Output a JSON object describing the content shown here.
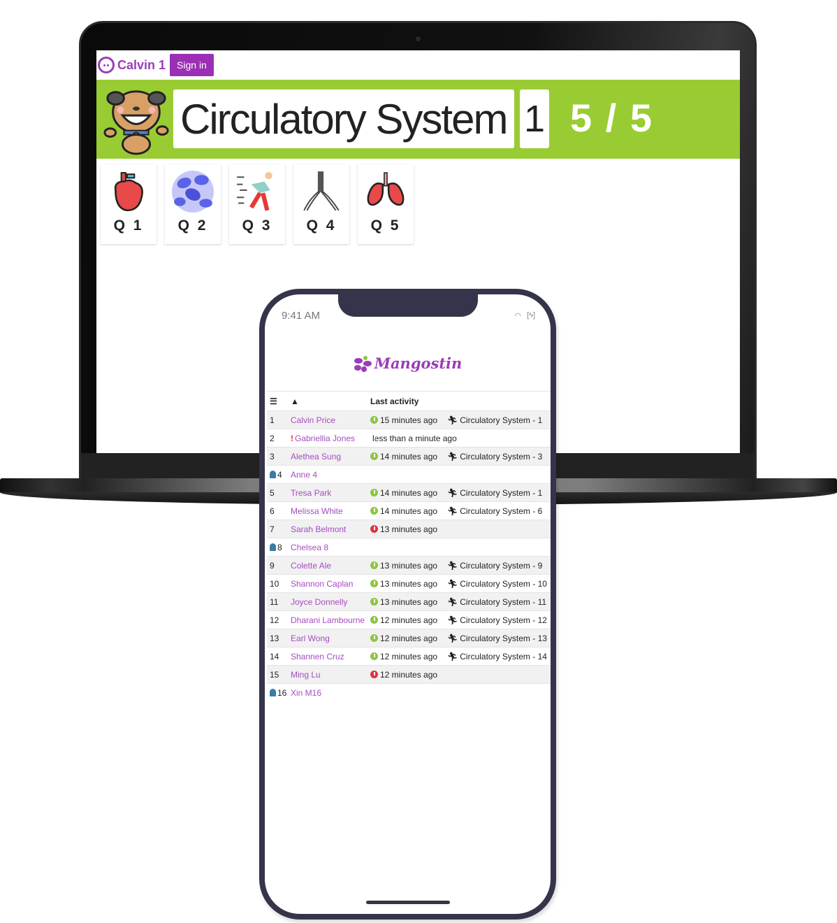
{
  "laptop": {
    "user_name": "Calvin 1",
    "signin_label": "Sign in",
    "quiz_title": "Circulatory System",
    "quiz_number": "1",
    "score": "5 / 5",
    "questions": [
      {
        "label": "Q 1",
        "icon": "heart-icon"
      },
      {
        "label": "Q 2",
        "icon": "blood-cells-icon"
      },
      {
        "label": "Q 3",
        "icon": "runner-icon"
      },
      {
        "label": "Q 4",
        "icon": "trachea-icon"
      },
      {
        "label": "Q 5",
        "icon": "lungs-icon"
      }
    ],
    "colors": {
      "brand": "#9b2fb5",
      "banner": "#99cc33"
    }
  },
  "phone": {
    "time": "9:41 AM",
    "logo": "Mangostin",
    "table": {
      "header": {
        "activity": "Last activity"
      },
      "rows": [
        {
          "num": "1",
          "name": "Calvin Price",
          "status": "green",
          "time": "15 minutes ago",
          "activity": "Circulatory System - 1"
        },
        {
          "num": "2",
          "name": "Gabriellia Jones",
          "alert": true,
          "status": "red",
          "time": "less than a minute ago",
          "activity": ""
        },
        {
          "num": "3",
          "name": "Alethea Sung",
          "status": "green",
          "time": "14 minutes ago",
          "activity": "Circulatory System - 3"
        },
        {
          "num": "4",
          "name": "Anne 4",
          "ghost": true,
          "status": "",
          "time": "",
          "activity": ""
        },
        {
          "num": "5",
          "name": "Tresa Park",
          "status": "green",
          "time": "14 minutes ago",
          "activity": "Circulatory System - 1"
        },
        {
          "num": "6",
          "name": "Melissa White",
          "status": "green",
          "time": "14 minutes ago",
          "activity": "Circulatory System - 6"
        },
        {
          "num": "7",
          "name": "Sarah Belmont",
          "status": "red",
          "time": "13 minutes ago",
          "activity": ""
        },
        {
          "num": "8",
          "name": "Chelsea 8",
          "ghost": true,
          "status": "",
          "time": "",
          "activity": ""
        },
        {
          "num": "9",
          "name": "Colette Ale",
          "status": "green",
          "time": "13 minutes ago",
          "activity": "Circulatory System - 9"
        },
        {
          "num": "10",
          "name": "Shannon Caplan",
          "status": "green",
          "time": "13 minutes ago",
          "activity": "Circulatory System - 10"
        },
        {
          "num": "11",
          "name": "Joyce Donnelly",
          "status": "green",
          "time": "13 minutes ago",
          "activity": "Circulatory System - 11"
        },
        {
          "num": "12",
          "name": "Dharani Lambourne",
          "status": "green",
          "time": "12 minutes ago",
          "activity": "Circulatory System - 12"
        },
        {
          "num": "13",
          "name": "Earl Wong",
          "status": "green",
          "time": "12 minutes ago",
          "activity": "Circulatory System - 13"
        },
        {
          "num": "14",
          "name": "Shannen Cruz",
          "status": "green",
          "time": "12 minutes ago",
          "activity": "Circulatory System - 14"
        },
        {
          "num": "15",
          "name": "Ming Lu",
          "status": "red",
          "time": "12 minutes ago",
          "activity": ""
        },
        {
          "num": "16",
          "name": "Xin M16",
          "ghost": true,
          "status": "",
          "time": "",
          "activity": ""
        }
      ]
    }
  }
}
